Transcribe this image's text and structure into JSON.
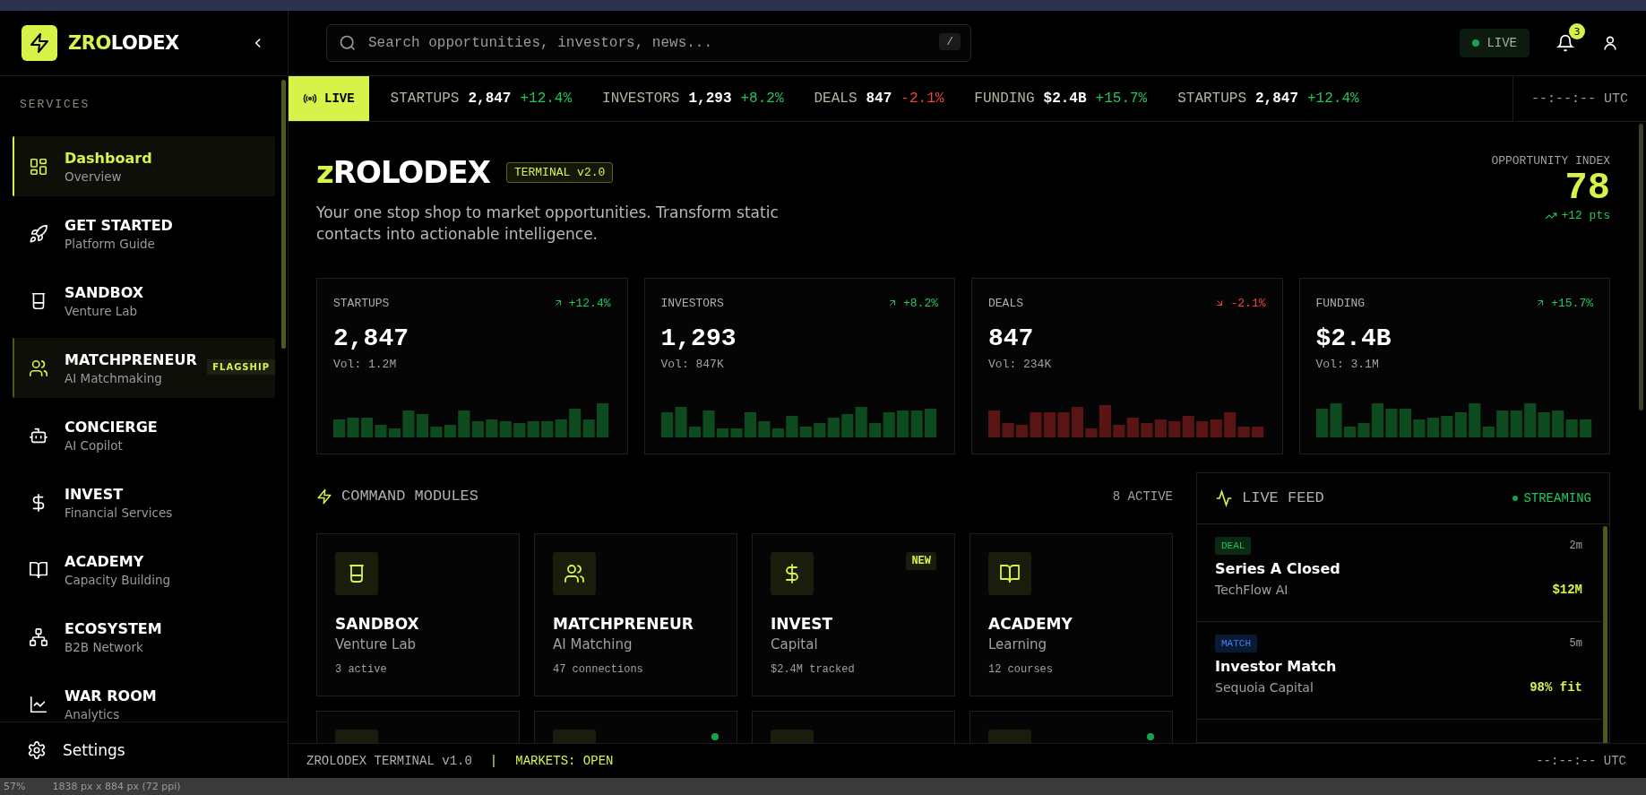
{
  "app": {
    "logo_prefix": "ZRO",
    "logo_suffix": "LODEX"
  },
  "sidebar": {
    "section_label": "SERVICES",
    "items": [
      {
        "title": "Dashboard",
        "subtitle": "Overview",
        "selected": true,
        "featured": false
      },
      {
        "title": "GET STARTED",
        "subtitle": "Platform Guide",
        "selected": false,
        "featured": false
      },
      {
        "title": "SANDBOX",
        "subtitle": "Venture Lab",
        "selected": false,
        "featured": false
      },
      {
        "title": "MATCHPRENEUR",
        "subtitle": "AI Matchmaking",
        "selected": false,
        "featured": true,
        "badge": "FLAGSHIP"
      },
      {
        "title": "CONCIERGE",
        "subtitle": "AI Copilot",
        "selected": false,
        "featured": false
      },
      {
        "title": "INVEST",
        "subtitle": "Financial Services",
        "selected": false,
        "featured": false
      },
      {
        "title": "ACADEMY",
        "subtitle": "Capacity Building",
        "selected": false,
        "featured": false
      },
      {
        "title": "ECOSYSTEM",
        "subtitle": "B2B Network",
        "selected": false,
        "featured": false
      },
      {
        "title": "WAR ROOM",
        "subtitle": "Analytics",
        "selected": false,
        "featured": false
      }
    ],
    "settings": "Settings"
  },
  "header": {
    "search_placeholder": "Search opportunities, investors, news...",
    "search_shortcut": "/",
    "live_status": "LIVE",
    "notification_count": "3"
  },
  "ticker": {
    "label": "LIVE",
    "items": [
      {
        "label": "STARTUPS",
        "value": "2,847",
        "change": "+12.4%",
        "rising": true
      },
      {
        "label": "INVESTORS",
        "value": "1,293",
        "change": "+8.2%",
        "rising": true
      },
      {
        "label": "DEALS",
        "value": "847",
        "change": "-2.1%",
        "rising": false
      },
      {
        "label": "FUNDING",
        "value": "$2.4B",
        "change": "+15.7%",
        "rising": true
      },
      {
        "label": "STARTUPS",
        "value": "2,847",
        "change": "+12.4%",
        "rising": true
      }
    ],
    "clock": "--:--:-- UTC"
  },
  "hero": {
    "title_prefix": "z",
    "title_main": "ROLODEX",
    "badge": "TERMINAL v2.0",
    "description": "Your one stop shop to market opportunities. Transform static contacts into actionable intelligence.",
    "index_label": "OPPORTUNITY INDEX",
    "index_value": "78",
    "index_change": "+12 pts"
  },
  "stats": [
    {
      "label": "STARTUPS",
      "change": "+12.4%",
      "rising": true,
      "value": "2,847",
      "volume": "Vol: 1.2M"
    },
    {
      "label": "INVESTORS",
      "change": "+8.2%",
      "rising": true,
      "value": "1,293",
      "volume": "Vol: 847K"
    },
    {
      "label": "DEALS",
      "change": "-2.1%",
      "rising": false,
      "value": "847",
      "volume": "Vol: 234K"
    },
    {
      "label": "FUNDING",
      "change": "+15.7%",
      "rising": true,
      "value": "$2.4B",
      "volume": "Vol: 3.1M"
    }
  ],
  "modules": {
    "title": "COMMAND MODULES",
    "count": "8 ACTIVE",
    "cards": [
      {
        "title": "SANDBOX",
        "subtitle": "Venture Lab",
        "meta": "3 active"
      },
      {
        "title": "MATCHPRENEUR",
        "subtitle": "AI Matching",
        "meta": "47 connections"
      },
      {
        "title": "INVEST",
        "subtitle": "Capital",
        "meta": "$2.4M tracked",
        "badge": "NEW"
      },
      {
        "title": "ACADEMY",
        "subtitle": "Learning",
        "meta": "12 courses"
      }
    ],
    "more_cards": [
      {
        "live": false
      },
      {
        "live": true
      },
      {
        "live": false
      },
      {
        "live": true
      }
    ]
  },
  "live_feed": {
    "title": "LIVE FEED",
    "status": "STREAMING",
    "items": [
      {
        "tag": "DEAL",
        "kind": "deal",
        "time": "2m",
        "title": "Series A Closed",
        "subtitle": "TechFlow AI",
        "value": "$12M"
      },
      {
        "tag": "MATCH",
        "kind": "match",
        "time": "5m",
        "title": "Investor Match",
        "subtitle": "Sequoia Capital",
        "value": "98% fit"
      }
    ]
  },
  "footer": {
    "version": "ZROLODEX TERMINAL v1.0",
    "separator": "|",
    "market": "MARKETS: OPEN",
    "clock": "--:--:-- UTC"
  },
  "editor_status": {
    "zoom": "57%",
    "size": "1838 px x 884 px (72 ppi)"
  }
}
